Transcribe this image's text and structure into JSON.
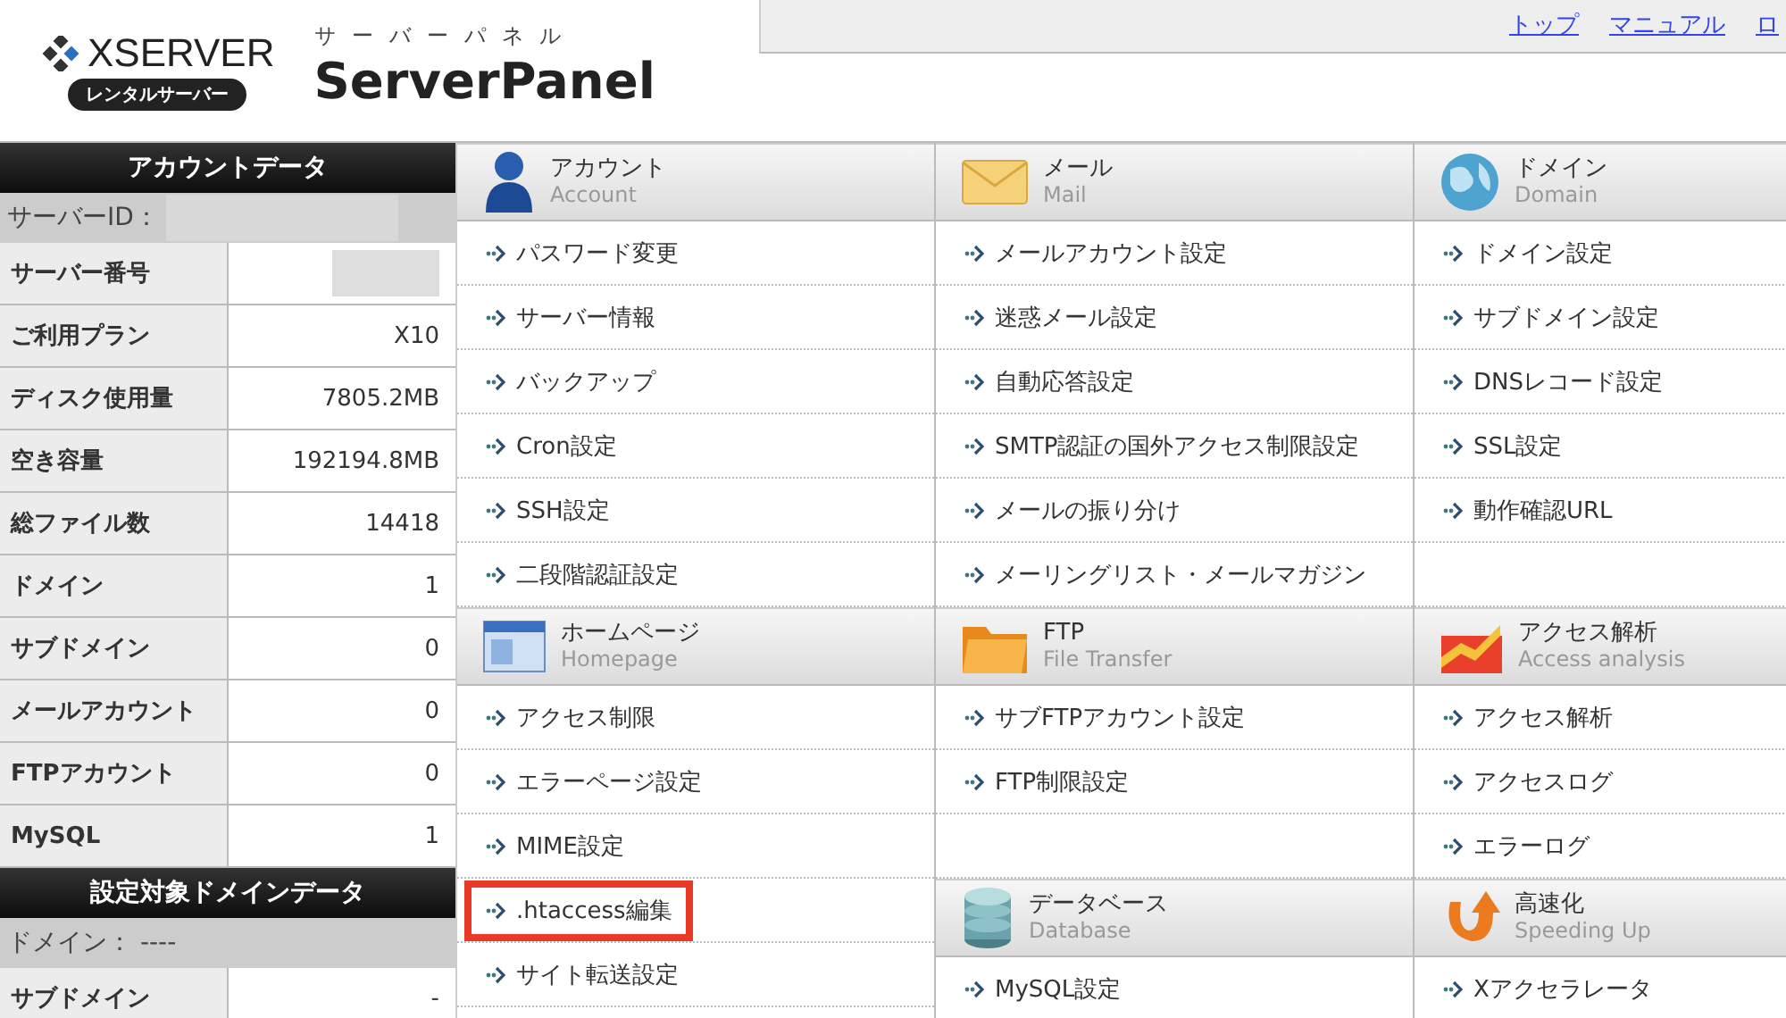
{
  "header": {
    "brand": "XSERVER",
    "brand_badge": "レンタルサーバー",
    "product_kana": "サーバーパネル",
    "product": "ServerPanel"
  },
  "top_links": [
    "トップ",
    "マニュアル",
    "ロ"
  ],
  "sidebar": [
    {
      "title": "アカウントデータ",
      "rows": [
        {
          "kind": "banner",
          "label": "サーバーID：",
          "redacted": true
        },
        {
          "kind": "pair",
          "label": "サーバー番号",
          "redacted": true
        },
        {
          "kind": "pair",
          "label": "ご利用プラン",
          "value": "X10",
          "redacted": false
        },
        {
          "kind": "pair",
          "label": "ディスク使用量",
          "value": "7805.2MB",
          "redacted": false
        },
        {
          "kind": "pair",
          "label": "空き容量",
          "value": "192194.8MB",
          "redacted": false
        },
        {
          "kind": "pair",
          "label": "総ファイル数",
          "value": "14418",
          "redacted": false
        },
        {
          "kind": "pair",
          "label": "ドメイン",
          "value": "1",
          "redacted": false
        },
        {
          "kind": "pair",
          "label": "サブドメイン",
          "value": "0",
          "redacted": false
        },
        {
          "kind": "pair",
          "label": "メールアカウント",
          "value": "0",
          "redacted": false
        },
        {
          "kind": "pair",
          "label": "FTPアカウント",
          "value": "0",
          "redacted": false
        },
        {
          "kind": "pair",
          "label": "MySQL",
          "value": "1",
          "redacted": false
        }
      ]
    },
    {
      "title": "設定対象ドメインデータ",
      "rows": [
        {
          "kind": "banner",
          "label": "ドメイン： ----",
          "redacted": false
        },
        {
          "kind": "pair",
          "label": "サブドメイン",
          "value": "-",
          "redacted": false
        }
      ]
    }
  ],
  "menu_columns": [
    [
      {
        "title": "アカウント",
        "subtitle": "Account",
        "items": [
          {
            "label": "パスワード変更",
            "highlighted": false
          },
          {
            "label": "サーバー情報",
            "highlighted": false
          },
          {
            "label": "バックアップ",
            "highlighted": false
          },
          {
            "label": "Cron設定",
            "highlighted": false
          },
          {
            "label": "SSH設定",
            "highlighted": false
          },
          {
            "label": "二段階認証設定",
            "highlighted": false
          }
        ]
      },
      {
        "title": "ホームページ",
        "subtitle": "Homepage",
        "items": [
          {
            "label": "アクセス制限",
            "highlighted": false
          },
          {
            "label": "エラーページ設定",
            "highlighted": false
          },
          {
            "label": "MIME設定",
            "highlighted": false
          },
          {
            "label": ".htaccess編集",
            "highlighted": true
          },
          {
            "label": "サイト転送設定",
            "highlighted": false
          }
        ]
      }
    ],
    [
      {
        "title": "メール",
        "subtitle": "Mail",
        "items": [
          {
            "label": "メールアカウント設定",
            "highlighted": false
          },
          {
            "label": "迷惑メール設定",
            "highlighted": false
          },
          {
            "label": "自動応答設定",
            "highlighted": false
          },
          {
            "label": "SMTP認証の国外アクセス制限設定",
            "highlighted": false
          },
          {
            "label": "メールの振り分け",
            "highlighted": false
          },
          {
            "label": "メーリングリスト・メールマガジン",
            "highlighted": false
          }
        ]
      },
      {
        "title": "FTP",
        "subtitle": "File Transfer",
        "items": [
          {
            "label": "サブFTPアカウント設定",
            "highlighted": false
          },
          {
            "label": "FTP制限設定",
            "highlighted": false
          }
        ]
      },
      {
        "title": "データベース",
        "subtitle": "Database",
        "items": [
          {
            "label": "MySQL設定",
            "highlighted": false
          }
        ]
      }
    ],
    [
      {
        "title": "ドメイン",
        "subtitle": "Domain",
        "items": [
          {
            "label": "ドメイン設定",
            "highlighted": false
          },
          {
            "label": "サブドメイン設定",
            "highlighted": false
          },
          {
            "label": "DNSレコード設定",
            "highlighted": false
          },
          {
            "label": "SSL設定",
            "highlighted": false
          },
          {
            "label": "動作確認URL",
            "highlighted": false
          }
        ]
      },
      {
        "title": "アクセス解析",
        "subtitle": "Access analysis",
        "items": [
          {
            "label": "アクセス解析",
            "highlighted": false
          },
          {
            "label": "アクセスログ",
            "highlighted": false
          },
          {
            "label": "エラーログ",
            "highlighted": false
          }
        ]
      },
      {
        "title": "高速化",
        "subtitle": "Speeding Up",
        "items": [
          {
            "label": "Xアクセラレータ",
            "highlighted": false
          }
        ]
      }
    ]
  ]
}
